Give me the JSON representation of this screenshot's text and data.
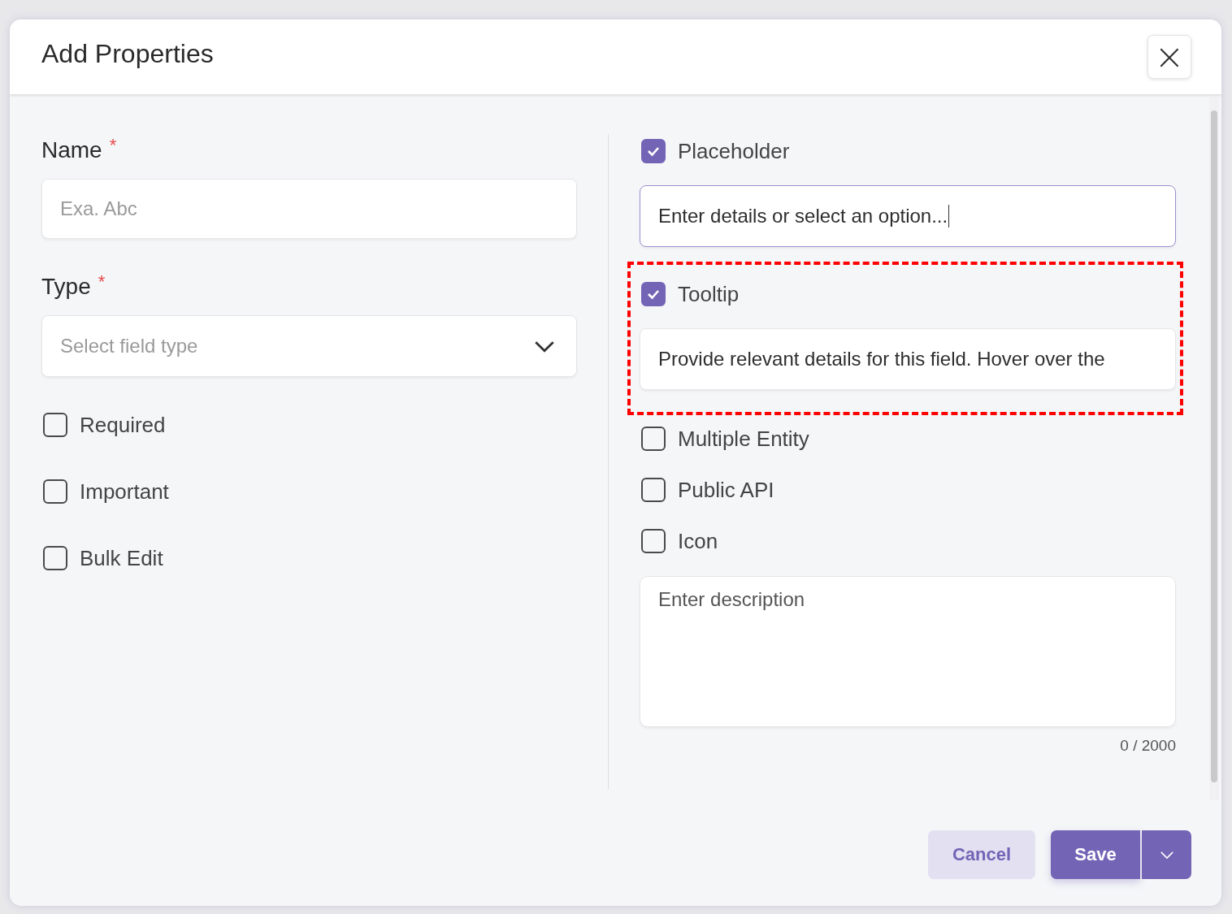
{
  "dialog": {
    "title": "Add Properties",
    "close_icon": "×"
  },
  "left": {
    "fields": [
      {
        "kind": "text",
        "label": "Name",
        "required": true,
        "required_mark": "*",
        "placeholder": "Exa. Abc"
      },
      {
        "kind": "select",
        "label": "Type",
        "required": true,
        "required_mark": "*",
        "placeholder": "Select field type"
      }
    ],
    "checkboxes": [
      {
        "label": "Required",
        "checked": false
      },
      {
        "label": "Important",
        "checked": false
      },
      {
        "label": "Bulk Edit",
        "checked": false
      }
    ]
  },
  "right": {
    "options": [
      {
        "label": "Placeholder",
        "checked": true,
        "value": "Enter details or select an option...",
        "focused": true,
        "highlighted": false
      },
      {
        "label": "Tooltip",
        "checked": true,
        "value": "Provide relevant details for this field. Hover over the",
        "focused": false,
        "highlighted": true
      }
    ],
    "checkboxes": [
      {
        "label": "Multiple Entity",
        "checked": false
      },
      {
        "label": "Public API",
        "checked": false
      },
      {
        "label": "Icon",
        "checked": false
      }
    ],
    "description": {
      "placeholder": "Enter description",
      "counter": "0 / 2000"
    }
  },
  "buttons": [
    {
      "kind": "secondary",
      "label": "Cancel"
    },
    {
      "kind": "primary",
      "label": "Save"
    },
    {
      "kind": "menu"
    }
  ]
}
